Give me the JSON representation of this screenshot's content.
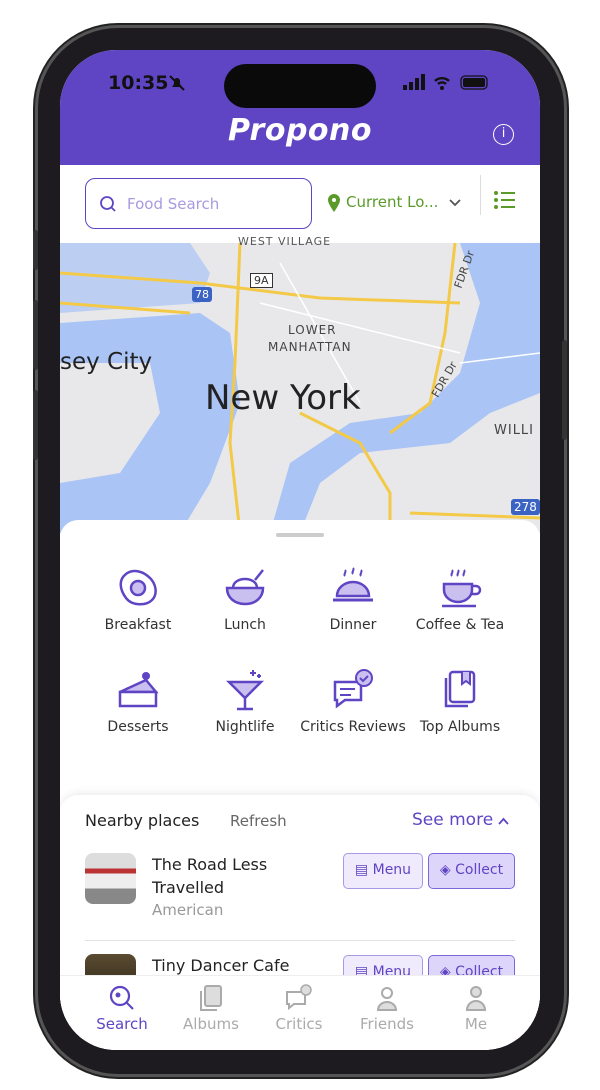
{
  "status": {
    "time": "10:35"
  },
  "header": {
    "logo": "Propono"
  },
  "search": {
    "placeholder": "Food Search",
    "location": "Current Lo..."
  },
  "map": {
    "labels": [
      "WEST VILLAGE",
      "78",
      "9A",
      "LOWER",
      "MANHATTAN",
      "sey City",
      "New York",
      "FDR Dr",
      "FDR Dr",
      "WILLI",
      "278"
    ]
  },
  "categories": [
    "Breakfast",
    "Lunch",
    "Dinner",
    "Coffee & Tea",
    "Desserts",
    "Nightlife",
    "Critics Reviews",
    "Top Albums"
  ],
  "nearby": {
    "title": "Nearby places",
    "refresh": "Refresh",
    "see_more": "See more",
    "places": [
      {
        "name": "The Road Less Travelled",
        "cuisine": "American",
        "menu": "Menu",
        "collect": "Collect"
      },
      {
        "name": "Tiny Dancer Cafe",
        "menu": "Menu",
        "collect": "Collect"
      }
    ]
  },
  "tabs": [
    {
      "label": "Search",
      "active": true
    },
    {
      "label": "Albums"
    },
    {
      "label": "Critics"
    },
    {
      "label": "Friends"
    },
    {
      "label": "Me"
    }
  ],
  "colors": {
    "brand": "#5f45c4",
    "location": "#5b9a2a"
  }
}
